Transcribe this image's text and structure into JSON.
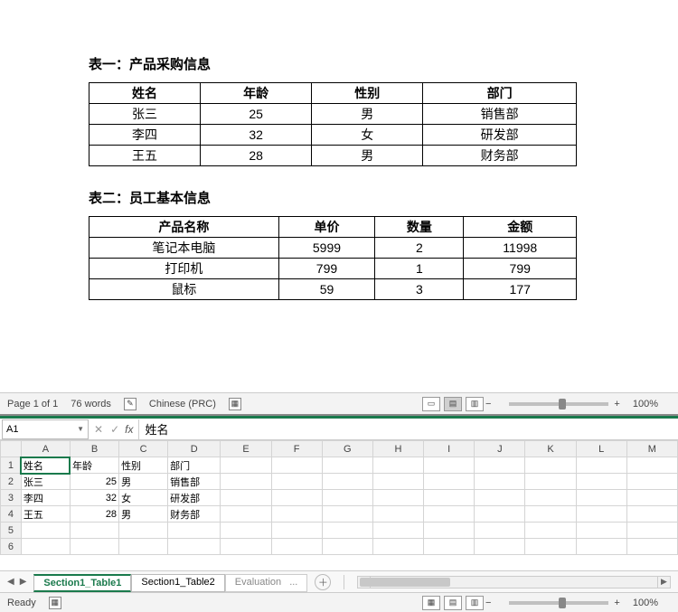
{
  "word": {
    "table1_title": "表一：产品采购信息",
    "table1": {
      "headers": [
        "姓名",
        "年龄",
        "性别",
        "部门"
      ],
      "rows": [
        [
          "张三",
          "25",
          "男",
          "销售部"
        ],
        [
          "李四",
          "32",
          "女",
          "研发部"
        ],
        [
          "王五",
          "28",
          "男",
          "财务部"
        ]
      ]
    },
    "table2_title": "表二：员工基本信息",
    "table2": {
      "headers": [
        "产品名称",
        "单价",
        "数量",
        "金额"
      ],
      "rows": [
        [
          "笔记本电脑",
          "5999",
          "2",
          "11998"
        ],
        [
          "打印机",
          "799",
          "1",
          "799"
        ],
        [
          "鼠标",
          "59",
          "3",
          "177"
        ]
      ]
    },
    "status": {
      "page": "Page 1 of 1",
      "words": "76 words",
      "lang": "Chinese (PRC)",
      "zoom": "100%"
    }
  },
  "excel": {
    "name_box": "A1",
    "formula_value": "姓名",
    "columns": [
      "A",
      "B",
      "C",
      "D",
      "E",
      "F",
      "G",
      "H",
      "I",
      "J",
      "K",
      "L",
      "M"
    ],
    "rows": [
      {
        "n": "1",
        "cells": [
          "姓名",
          "年龄",
          "性别",
          "部门",
          "",
          "",
          "",
          "",
          "",
          "",
          "",
          "",
          ""
        ]
      },
      {
        "n": "2",
        "cells": [
          "张三",
          "25",
          "男",
          "销售部",
          "",
          "",
          "",
          "",
          "",
          "",
          "",
          "",
          ""
        ]
      },
      {
        "n": "3",
        "cells": [
          "李四",
          "32",
          "女",
          "研发部",
          "",
          "",
          "",
          "",
          "",
          "",
          "",
          "",
          ""
        ]
      },
      {
        "n": "4",
        "cells": [
          "王五",
          "28",
          "男",
          "财务部",
          "",
          "",
          "",
          "",
          "",
          "",
          "",
          "",
          ""
        ]
      },
      {
        "n": "5",
        "cells": [
          "",
          "",
          "",
          "",
          "",
          "",
          "",
          "",
          "",
          "",
          "",
          "",
          ""
        ]
      },
      {
        "n": "6",
        "cells": [
          "",
          "",
          "",
          "",
          "",
          "",
          "",
          "",
          "",
          "",
          "",
          "",
          ""
        ]
      }
    ],
    "tabs": {
      "active": "Section1_Table1",
      "t2": "Section1_Table2",
      "t3": "Evaluation",
      "ellipsis": "..."
    },
    "status": {
      "ready": "Ready",
      "zoom": "100%"
    }
  }
}
